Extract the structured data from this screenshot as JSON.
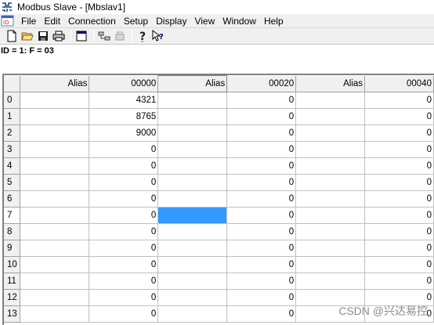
{
  "window": {
    "title": "Modbus Slave - [Mbslav1]",
    "app_icon": "modbus-app-icon"
  },
  "menu": [
    "File",
    "Edit",
    "Connection",
    "Setup",
    "Display",
    "View",
    "Window",
    "Help"
  ],
  "toolbar": {
    "icons": [
      "new-icon",
      "open-icon",
      "save-icon",
      "print-icon",
      "window-icon",
      "connect-icon",
      "disconnect-icon",
      "help-icon",
      "context-help-icon"
    ]
  },
  "status": {
    "text": "ID = 1: F = 03"
  },
  "grid": {
    "columns": [
      "Alias",
      "00000",
      "Alias",
      "00020",
      "Alias",
      "00040"
    ],
    "row_labels": [
      "0",
      "1",
      "2",
      "3",
      "4",
      "5",
      "6",
      "7",
      "8",
      "9",
      "10",
      "11",
      "12",
      "13"
    ],
    "rows": [
      [
        "",
        "4321",
        "",
        "0",
        "",
        "0"
      ],
      [
        "",
        "8765",
        "",
        "0",
        "",
        "0"
      ],
      [
        "",
        "9000",
        "",
        "0",
        "",
        "0"
      ],
      [
        "",
        "0",
        "",
        "0",
        "",
        "0"
      ],
      [
        "",
        "0",
        "",
        "0",
        "",
        "0"
      ],
      [
        "",
        "0",
        "",
        "0",
        "",
        "0"
      ],
      [
        "",
        "0",
        "",
        "0",
        "",
        "0"
      ],
      [
        "",
        "0",
        "",
        "0",
        "",
        "0"
      ],
      [
        "",
        "0",
        "",
        "0",
        "",
        "0"
      ],
      [
        "",
        "0",
        "",
        "0",
        "",
        "0"
      ],
      [
        "",
        "0",
        "",
        "0",
        "",
        "0"
      ],
      [
        "",
        "0",
        "",
        "0",
        "",
        "0"
      ],
      [
        "",
        "0",
        "",
        "0",
        "",
        "0"
      ],
      [
        "",
        "0",
        "",
        "0",
        "",
        "0"
      ]
    ],
    "selected_row": 7,
    "selected_col": 2,
    "selection_color": "#3399ff"
  },
  "watermark": {
    "text": "CSDN @兴达易控"
  }
}
